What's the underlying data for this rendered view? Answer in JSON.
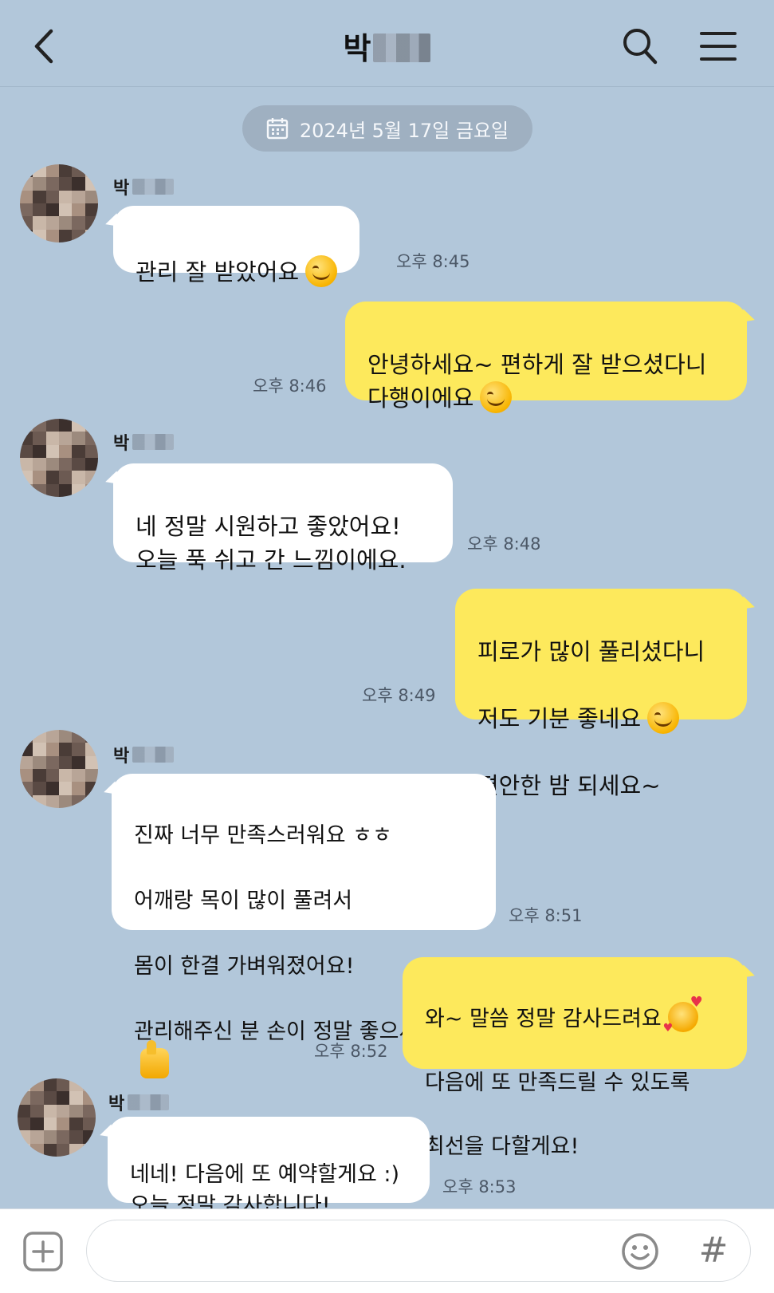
{
  "header": {
    "title": "박",
    "back_icon": "chevron-left-icon",
    "search_icon": "search-icon",
    "menu_icon": "hamburger-menu-icon"
  },
  "date_divider": {
    "icon": "calendar-icon",
    "text": "2024년 5월 17일 금요일"
  },
  "messages": [
    {
      "side": "in",
      "sender": "박",
      "text": "관리 잘 받았어요",
      "emoji": "smiling-face",
      "time": "오후 8:45"
    },
    {
      "side": "out",
      "text": "안녕하세요~ 편하게 잘 받으셨다니\n다행이에요",
      "emoji": "smiling-face",
      "time": "오후 8:46"
    },
    {
      "side": "in",
      "sender": "박",
      "text": "네 정말 시원하고 좋았어요!\n오늘 푹 쉬고 간 느낌이에요.",
      "time": "오후 8:48"
    },
    {
      "side": "out",
      "text_lines": [
        "피로가 많이 풀리셨다니",
        "저도 기분 좋네요",
        "편안한 밤 되세요~"
      ],
      "emoji": "smiling-face",
      "time": "오후 8:49"
    },
    {
      "side": "in",
      "sender": "박",
      "text_lines": [
        "진짜 너무 만족스러워요 ㅎㅎ",
        "어깨랑 목이 많이 풀려서",
        "몸이 한결 가벼워졌어요!",
        "관리해주신 분 손이 정말 좋으세요"
      ],
      "emoji": "thumbs-up",
      "time": "오후 8:51"
    },
    {
      "side": "out",
      "text_lines": [
        "와~ 말씀 정말 감사드려요",
        "다음에 또 만족드릴 수 있도록",
        "최선을 다할게요!"
      ],
      "emoji": "smiling-face-with-hearts",
      "time": "오후 8:52"
    },
    {
      "side": "in",
      "sender": "박",
      "text": "네네! 다음에 또 예약할게요 :)\n오늘 정말 감사합니다!",
      "time": "오후 8:53"
    }
  ],
  "composer": {
    "plus_icon": "plus-square-icon",
    "input_value": "",
    "emoji_icon": "emoji-smile-icon",
    "hash_label": "#"
  }
}
